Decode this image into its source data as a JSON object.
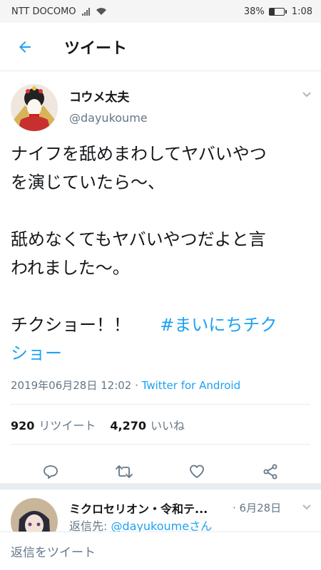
{
  "status_bar": {
    "carrier": "NTT DOCOMO",
    "battery": "38%",
    "battery_level": 0.38,
    "time": "1:08"
  },
  "app_bar": {
    "title": "ツイート"
  },
  "tweet": {
    "display_name": "コウメ太夫",
    "handle": "@dayukoume",
    "text_line1": "ナイフを舐めまわしてヤバいやつ",
    "text_line2": "を演じていたら〜、",
    "text_line3": "舐めなくてもヤバいやつだよと言",
    "text_line4": "われました〜。",
    "text_line5": "チクショー！！",
    "hashtag_part1": "#まいにちチク",
    "hashtag_part2": "ショー",
    "timestamp": "2019年06月28日 12:02 · ",
    "source": "Twitter for Android",
    "retweet_count": "920",
    "retweet_label": "リツイート",
    "like_count": "4,270",
    "like_label": "いいね"
  },
  "reply": {
    "display_name": "ミクロセリオン・令和テ...",
    "date": "· 6月28日",
    "reply_to_prefix": "返信先: ",
    "reply_to_handle": "@dayukoumeさん"
  },
  "compose": {
    "placeholder": "返信をツイート"
  },
  "colors": {
    "accent": "#1da1f2",
    "secondary_text": "#657786",
    "primary_text": "#14171a"
  }
}
